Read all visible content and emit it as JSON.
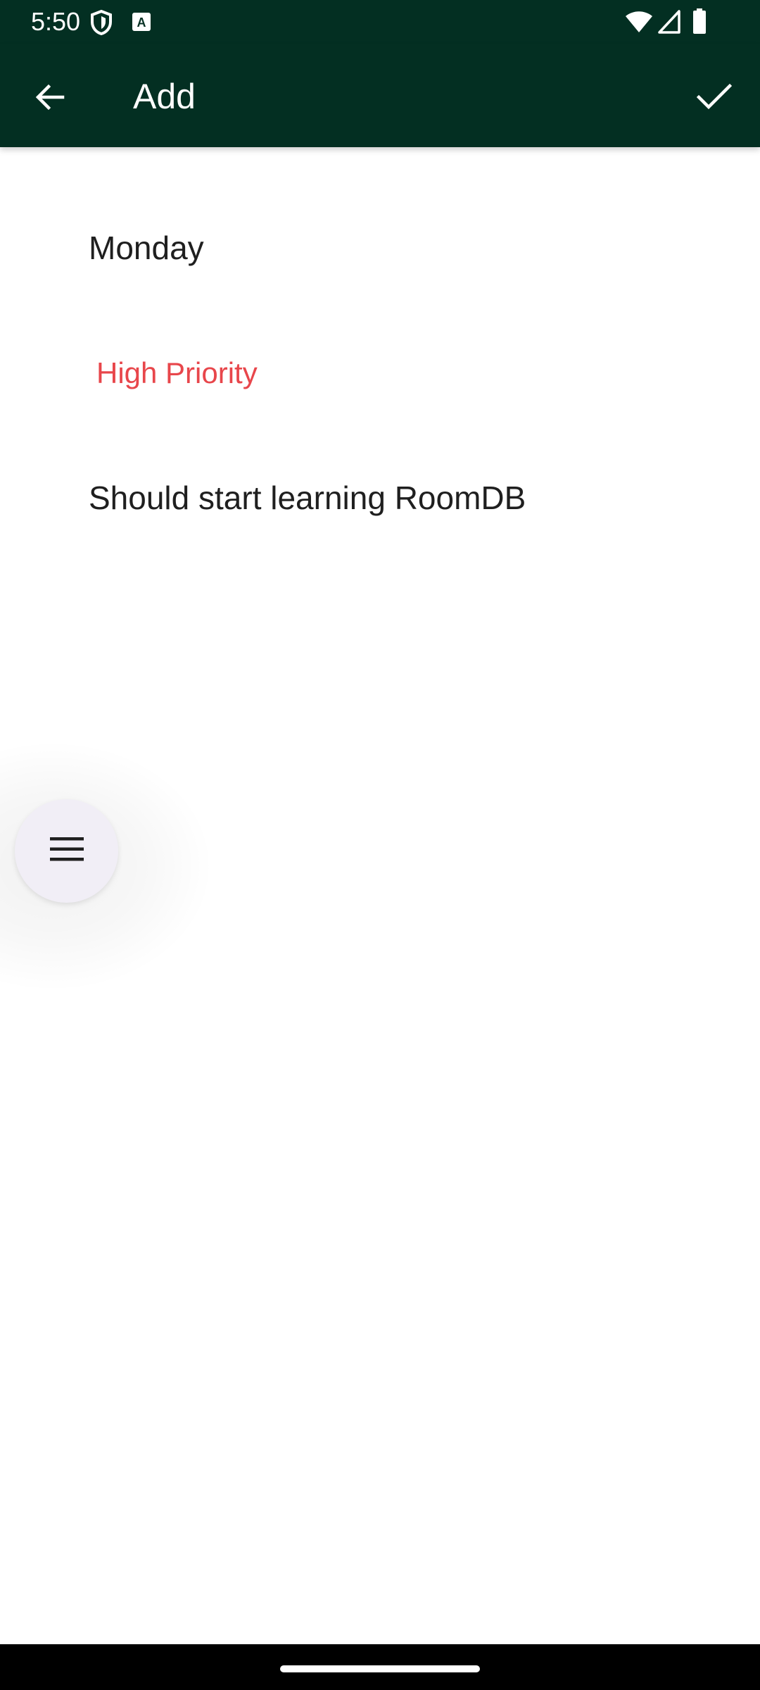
{
  "status_bar": {
    "time": "5:50",
    "icons": [
      "shield-icon",
      "keyboard-a-icon",
      "wifi-icon",
      "signal-icon",
      "battery-icon"
    ],
    "background": "#032f22"
  },
  "app_bar": {
    "title": "Add",
    "back_icon": "arrow-back-icon",
    "confirm_icon": "check-icon",
    "background": "#032f22"
  },
  "form": {
    "day": "Monday",
    "priority": "High Priority",
    "priority_color": "#e8464b",
    "note": "Should start learning RoomDB"
  },
  "fab": {
    "icon": "menu-icon"
  }
}
